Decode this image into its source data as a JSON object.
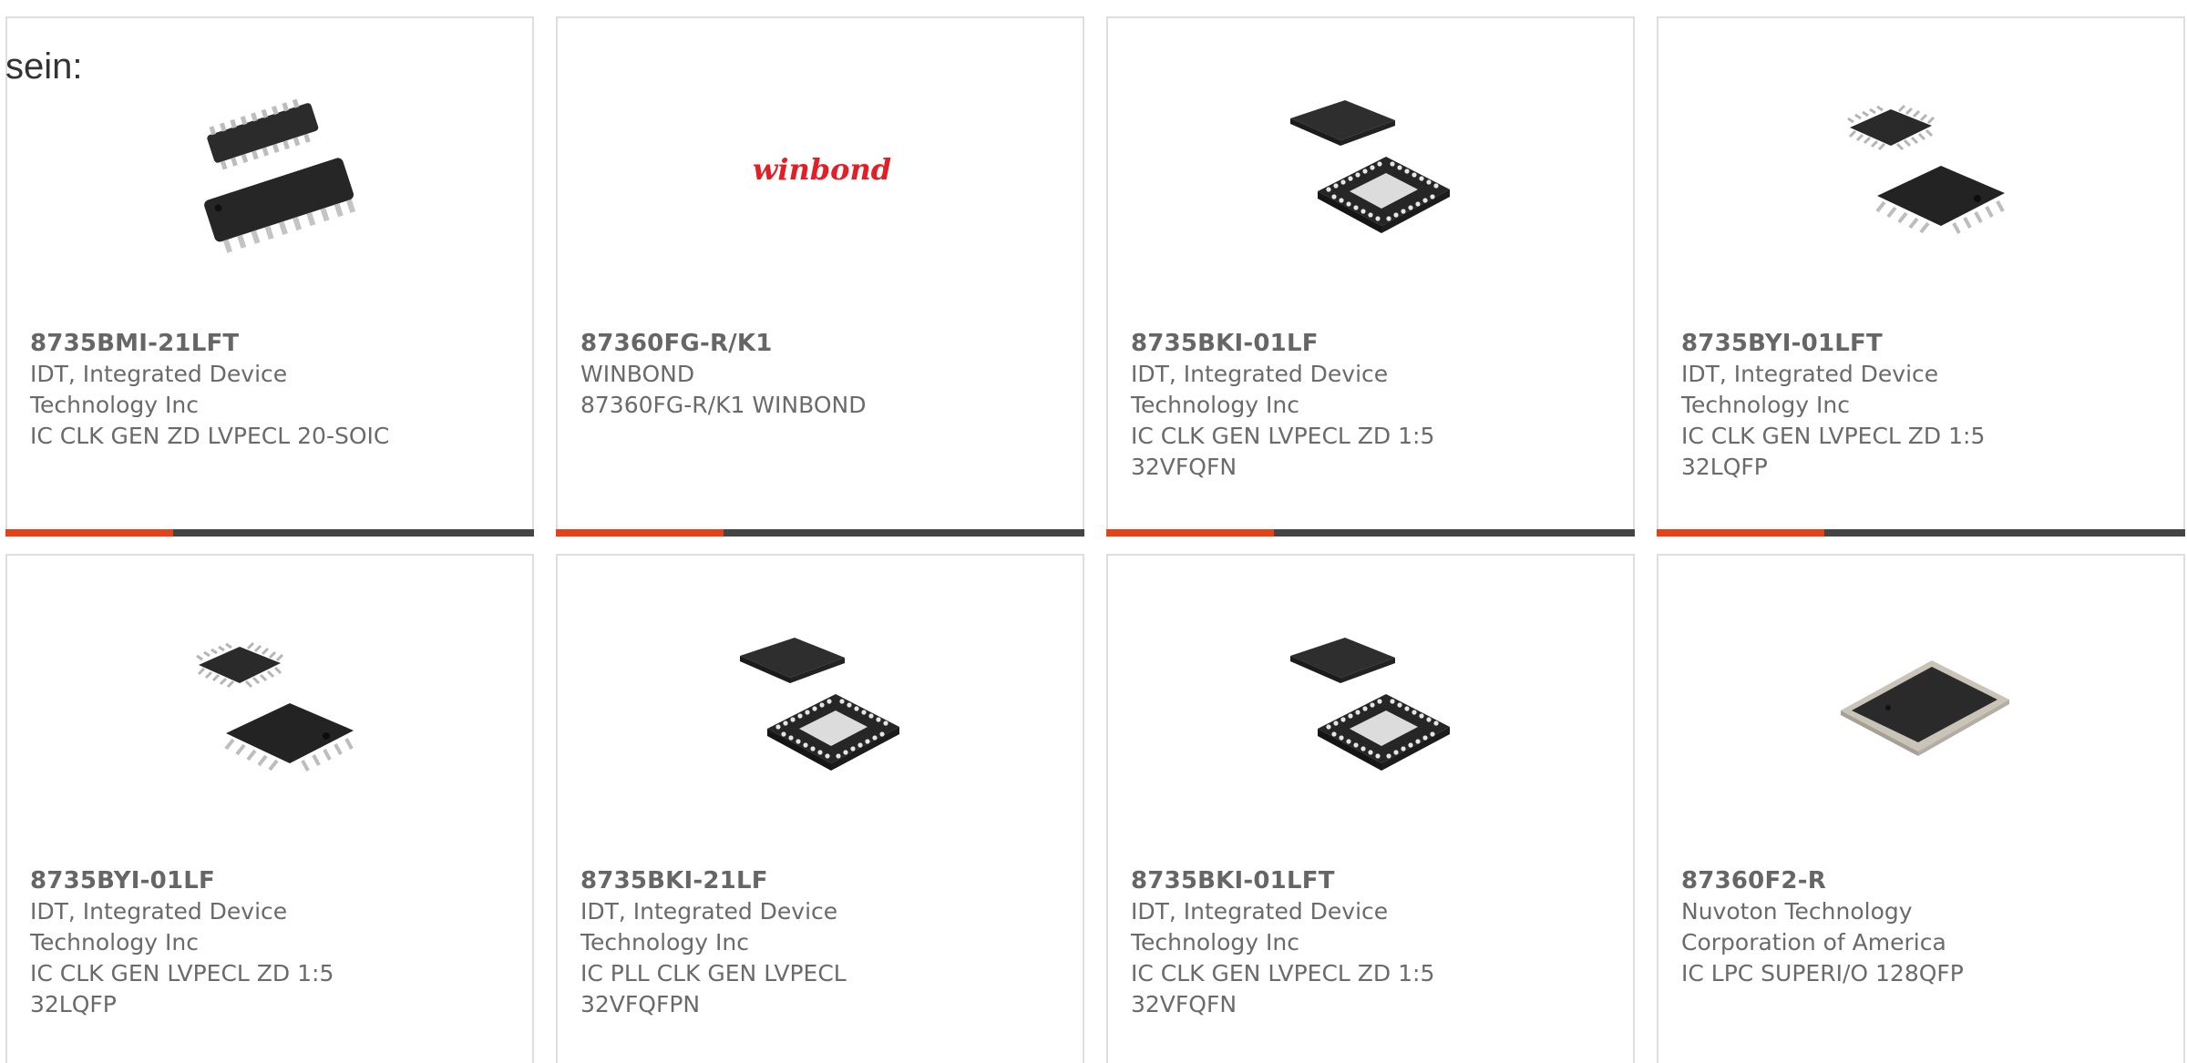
{
  "header": {
    "text": "sein:"
  },
  "colors": {
    "accent": "#e8411a",
    "bar": "#444444",
    "text": "#666666",
    "border": "#dedede"
  },
  "products": [
    {
      "part_number": "8735BMI-21LFT",
      "manufacturer": "IDT, Integrated Device Technology Inc",
      "description": "IC CLK GEN ZD LVPECL 20-SOIC",
      "image": "soic-chip-image"
    },
    {
      "part_number": "87360FG-R/K1",
      "manufacturer": "WINBOND",
      "description": "87360FG-R/K1 WINBOND",
      "image": "winbond-logo-image",
      "logo_text": "winbond"
    },
    {
      "part_number": "8735BKI-01LF",
      "manufacturer": "IDT, Integrated Device Technology Inc",
      "description": "IC CLK GEN LVPECL ZD 1:5 32VFQFN",
      "image": "qfn-chip-image"
    },
    {
      "part_number": "8735BYI-01LFT",
      "manufacturer": "IDT, Integrated Device Technology Inc",
      "description": "IC CLK GEN LVPECL ZD 1:5 32LQFP",
      "image": "lqfp-chip-image"
    },
    {
      "part_number": "8735BYI-01LF",
      "manufacturer": "IDT, Integrated Device Technology Inc",
      "description": "IC CLK GEN LVPECL ZD 1:5 32LQFP",
      "image": "lqfp-chip-image"
    },
    {
      "part_number": "8735BKI-21LF",
      "manufacturer": "IDT, Integrated Device Technology Inc",
      "description": "IC PLL CLK GEN LVPECL 32VFQFPN",
      "image": "qfn-chip-image"
    },
    {
      "part_number": "8735BKI-01LFT",
      "manufacturer": "IDT, Integrated Device Technology Inc",
      "description": "IC CLK GEN LVPECL ZD 1:5 32VFQFN",
      "image": "qfn-chip-image"
    },
    {
      "part_number": "87360F2-R",
      "manufacturer": "Nuvoton Technology Corporation of America",
      "description": "IC LPC SUPERI/O 128QFP",
      "image": "qfp128-chip-image"
    }
  ]
}
